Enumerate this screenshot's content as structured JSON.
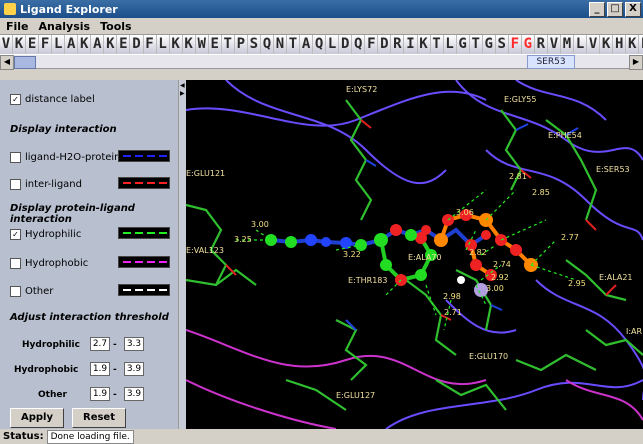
{
  "window": {
    "title": "Ligand Explorer",
    "min": "_",
    "max": "□",
    "close": "X"
  },
  "menu": [
    "File",
    "Analysis",
    "Tools"
  ],
  "sequence": {
    "residues": "VKEFLAKAKEDFLKKWETPSQNTAQLDQFDRIKTLGTGSFGRVMLVKHKESGNHYA",
    "highlight_indices": [
      39,
      40
    ],
    "selected_label": "SER53"
  },
  "options": {
    "distance_label": {
      "label": "distance label",
      "checked": true
    },
    "display_interaction_header": "Display interaction",
    "ligand_h2o_protein": {
      "label": "ligand-H2O-protein",
      "checked": false,
      "color": "#2222ff"
    },
    "inter_ligand": {
      "label": "inter-ligand",
      "checked": false,
      "color": "#ff2222"
    },
    "protein_ligand_header": "Display protein-ligand interaction",
    "hydrophilic": {
      "label": "Hydrophilic",
      "checked": true,
      "color": "#22ee22"
    },
    "hydrophobic": {
      "label": "Hydrophobic",
      "checked": false,
      "color": "#ee22ee"
    },
    "other": {
      "label": "Other",
      "checked": false,
      "color": "#ffffff"
    },
    "threshold_header": "Adjust interaction threshold"
  },
  "thresholds": {
    "hydrophilic": {
      "label": "Hydrophilic",
      "min": "2.7",
      "max": "3.3"
    },
    "hydrophobic": {
      "label": "Hydrophobic",
      "min": "1.9",
      "max": "3.9"
    },
    "other": {
      "label": "Other",
      "min": "1.9",
      "max": "3.9"
    },
    "sep": "-"
  },
  "buttons": {
    "apply": "Apply",
    "reset": "Reset"
  },
  "status": {
    "label": "Status:",
    "value": "Done loading file."
  },
  "residue_labels": [
    "E:LYS72",
    "E:GLY55",
    "E:PHE54",
    "E:SER53",
    "E:GLU121",
    "E:VAL123",
    "E:ALA70",
    "E:THR183",
    "E:ALA21",
    "E:GLU127",
    "E:GLU170",
    "I:AR"
  ],
  "distance_labels": [
    "3.00",
    "3.25",
    "3.22",
    "3.06",
    "2.81",
    "2.85",
    "2.77",
    "2.82",
    "2.74",
    "2.92",
    "3.00",
    "2.98",
    "2.71",
    "2.95"
  ]
}
